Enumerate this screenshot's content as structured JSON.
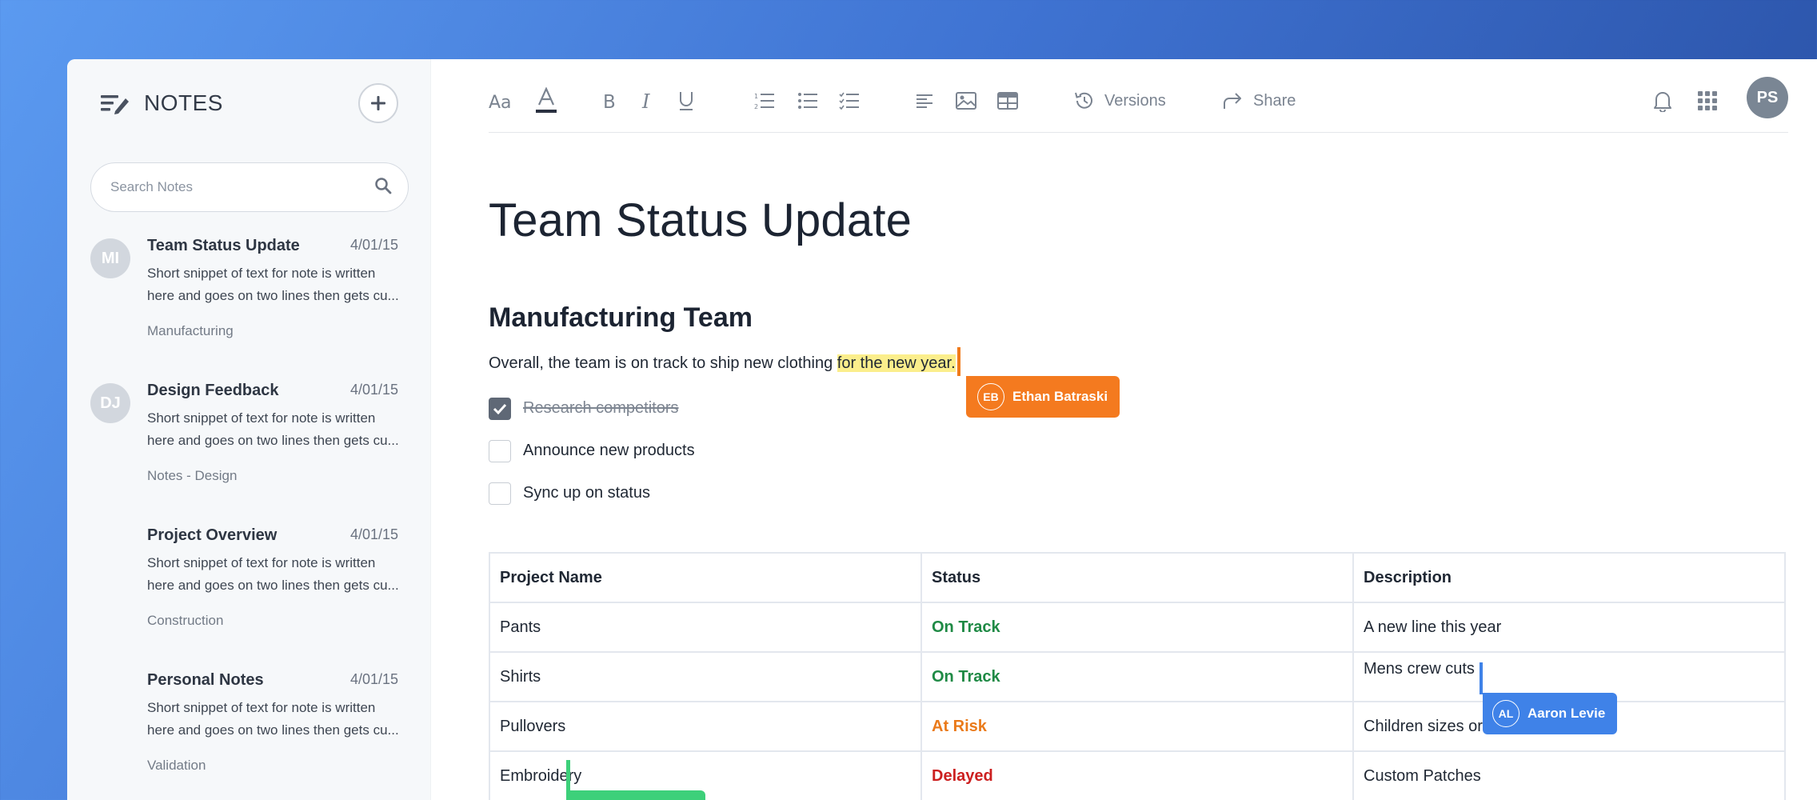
{
  "sidebar": {
    "title": "NOTES",
    "search_placeholder": "Search Notes",
    "notes": [
      {
        "initials": "MI",
        "title": "Team Status Update",
        "date": "4/01/15",
        "snippet": "Short snippet of text for note is written here and goes on two lines then gets cu...",
        "tag": "Manufacturing"
      },
      {
        "initials": "DJ",
        "title": "Design Feedback",
        "date": "4/01/15",
        "snippet": "Short snippet of text for note is written here and goes on two lines then gets cu...",
        "tag": "Notes - Design"
      },
      {
        "initials": "",
        "title": "Project Overview",
        "date": "4/01/15",
        "snippet": "Short snippet of text for note is written here and goes on two lines then gets cu...",
        "tag": "Construction"
      },
      {
        "initials": "",
        "title": "Personal Notes",
        "date": "4/01/15",
        "snippet": "Short snippet of text for note is written here and goes on two lines then gets cu...",
        "tag": "Validation"
      }
    ]
  },
  "toolbar": {
    "versions_label": "Versions",
    "share_label": "Share",
    "user_initials": "PS"
  },
  "document": {
    "title": "Team Status Update",
    "section": "Manufacturing Team",
    "para_before": "Overall, the team is on track to ship new clothing ",
    "para_highlight": "for the new year.",
    "checklist": [
      {
        "label": "Research competitors",
        "checked": true
      },
      {
        "label": "Announce new products",
        "checked": false
      },
      {
        "label": "Sync up on status",
        "checked": false
      }
    ],
    "table": {
      "headers": [
        "Project Name",
        "Status",
        "Description"
      ],
      "rows": [
        [
          "Pants",
          "On Track",
          "A new line this year"
        ],
        [
          "Shirts",
          "On Track",
          "Mens crew cuts"
        ],
        [
          "Pullovers",
          "At Risk",
          "Children sizes or"
        ],
        [
          "Embroidery",
          "Delayed",
          "Custom Patches"
        ]
      ]
    }
  },
  "collaborators": [
    {
      "initials": "EB",
      "name": "Ethan Batraski",
      "color": "#f47a1f"
    },
    {
      "initials": "AL",
      "name": "Aaron Levie",
      "color": "#3f82e8"
    },
    {
      "color": "#3dd07a"
    }
  ]
}
